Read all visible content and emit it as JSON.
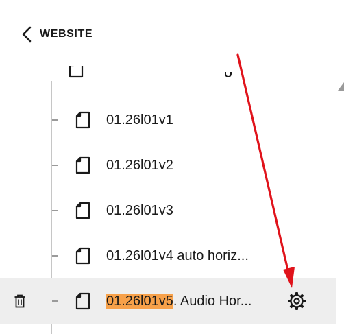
{
  "header": {
    "back_label": "WEBSITE"
  },
  "pages": [
    {
      "title": "01.26l01v1"
    },
    {
      "title": "01.26l01v2"
    },
    {
      "title": "01.26l01v3"
    },
    {
      "title": "01.26l01v4 auto horiz..."
    },
    {
      "title_highlight": "01.26l01v5",
      "title_rest": ". Audio Hor...",
      "selected": true
    }
  ],
  "colors": {
    "highlight": "#f7a14a",
    "selected_row": "#eeeeee",
    "annotation_arrow": "#e0131b"
  },
  "icons": {
    "back": "chevron-left-icon",
    "page": "page-icon",
    "delete": "trash-icon",
    "settings": "gear-icon"
  }
}
